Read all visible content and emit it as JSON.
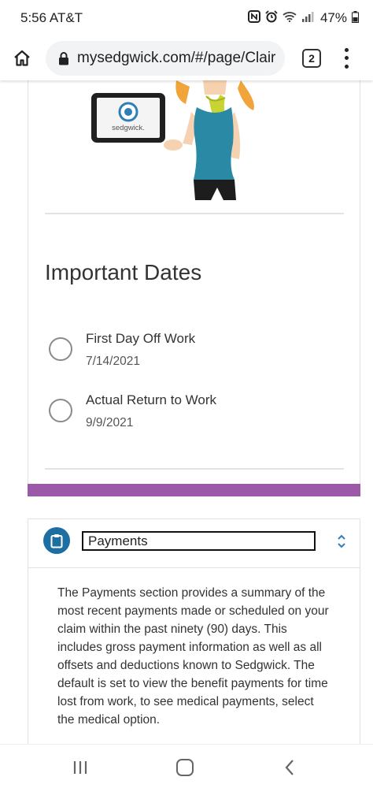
{
  "status_bar": {
    "time_carrier": "5:56 AT&T",
    "battery": "47%"
  },
  "browser": {
    "url": "mysedgwick.com/#/page/Clair",
    "tab_count": "2"
  },
  "illustration": {
    "tablet_brand": "sedgwick."
  },
  "important_dates": {
    "title": "Important Dates",
    "items": [
      {
        "label": "First Day Off Work",
        "date": "7/14/2021"
      },
      {
        "label": "Actual Return to Work",
        "date": "9/9/2021"
      }
    ]
  },
  "payments": {
    "title": "Payments",
    "description": "The Payments section provides a summary of the most recent payments made or scheduled on your claim within the past ninety (90) days. This includes gross payment information as well as all offsets and deductions known to Sedgwick. The default is set to view the benefit payments for time lost from work, to see medical payments, select the medical option."
  },
  "colors": {
    "accent_purple": "#9b59a8",
    "icon_blue": "#1c6fa0"
  }
}
